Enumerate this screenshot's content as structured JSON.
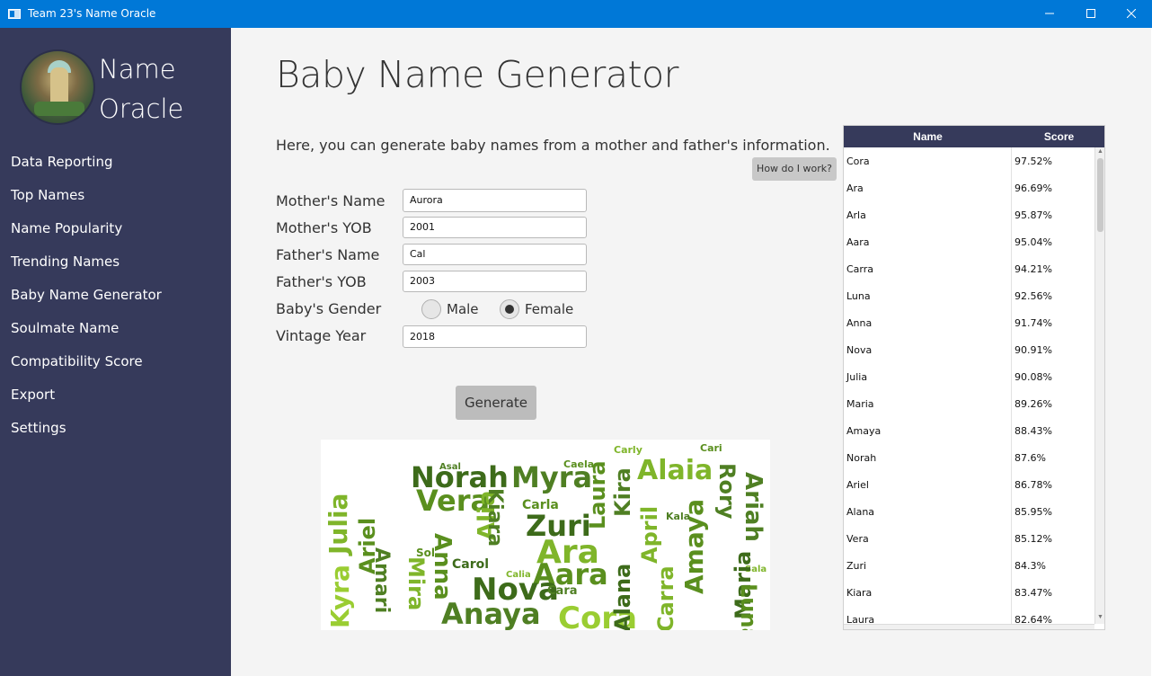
{
  "window": {
    "title": "Team 23's Name Oracle",
    "min_glyph": "—",
    "max_glyph": "☐",
    "close_glyph": "✕"
  },
  "sidebar": {
    "brand_line1": "Name",
    "brand_line2": "Oracle",
    "items": [
      {
        "label": "Data Reporting"
      },
      {
        "label": "Top Names"
      },
      {
        "label": "Name Popularity"
      },
      {
        "label": "Trending Names"
      },
      {
        "label": "Baby Name Generator"
      },
      {
        "label": "Soulmate Name"
      },
      {
        "label": "Compatibility Score"
      },
      {
        "label": "Export"
      },
      {
        "label": "Settings"
      }
    ]
  },
  "main": {
    "title": "Baby Name Generator",
    "intro": "Here, you can generate baby names from a mother and father's information.",
    "help_button": "How do I work?",
    "form": {
      "mother_name_label": "Mother's Name",
      "mother_name_value": "Aurora",
      "mother_yob_label": "Mother's YOB",
      "mother_yob_value": "2001",
      "father_name_label": "Father's Name",
      "father_name_value": "Cal",
      "father_yob_label": "Father's YOB",
      "father_yob_value": "2003",
      "gender_label": "Baby's Gender",
      "gender_male": "Male",
      "gender_female": "Female",
      "gender_selected": "Female",
      "vintage_label": "Vintage Year",
      "vintage_value": "2018"
    },
    "generate_button": "Generate"
  },
  "results": {
    "col_name": "Name",
    "col_score": "Score",
    "rows": [
      {
        "name": "Cora",
        "score": "97.52%"
      },
      {
        "name": "Ara",
        "score": "96.69%"
      },
      {
        "name": "Arla",
        "score": "95.87%"
      },
      {
        "name": "Aara",
        "score": "95.04%"
      },
      {
        "name": "Carra",
        "score": "94.21%"
      },
      {
        "name": "Luna",
        "score": "92.56%"
      },
      {
        "name": "Anna",
        "score": "91.74%"
      },
      {
        "name": "Nova",
        "score": "90.91%"
      },
      {
        "name": "Julia",
        "score": "90.08%"
      },
      {
        "name": "Maria",
        "score": "89.26%"
      },
      {
        "name": "Amaya",
        "score": "88.43%"
      },
      {
        "name": "Norah",
        "score": "87.6%"
      },
      {
        "name": "Ariel",
        "score": "86.78%"
      },
      {
        "name": "Alana",
        "score": "85.95%"
      },
      {
        "name": "Vera",
        "score": "85.12%"
      },
      {
        "name": "Zuri",
        "score": "84.3%"
      },
      {
        "name": "Kiara",
        "score": "83.47%"
      },
      {
        "name": "Laura",
        "score": "82.64%"
      }
    ]
  },
  "word_cloud": {
    "colors": [
      "#3d6b1a",
      "#5a8f1e",
      "#7fb52a",
      "#9acd32",
      "#4f7f23",
      "#2f5a12"
    ],
    "words": [
      {
        "text": "Norah",
        "color": "#3d6b1a"
      },
      {
        "text": "Myra",
        "color": "#4f7f23"
      },
      {
        "text": "Alaia",
        "color": "#7fb52a"
      },
      {
        "text": "Vera",
        "color": "#5a8f1e"
      },
      {
        "text": "Zuri",
        "color": "#3d6b1a"
      },
      {
        "text": "Ara",
        "color": "#7fb52a"
      },
      {
        "text": "Aara",
        "color": "#5a8f1e"
      },
      {
        "text": "Nova",
        "color": "#3d6b1a"
      },
      {
        "text": "Anaya",
        "color": "#4f7f23"
      },
      {
        "text": "Cora",
        "color": "#9acd32"
      },
      {
        "text": "Carla",
        "color": "#5a8f1e"
      },
      {
        "text": "Carol",
        "color": "#3d6b1a"
      },
      {
        "text": "Cara",
        "color": "#4f7f23"
      },
      {
        "text": "Caela",
        "color": "#5a8f1e"
      },
      {
        "text": "Carly",
        "color": "#7fb52a"
      },
      {
        "text": "Cari",
        "color": "#5a8f1e"
      },
      {
        "text": "Asal",
        "color": "#4f7f23"
      },
      {
        "text": "Sol",
        "color": "#5a8f1e"
      },
      {
        "text": "Kala",
        "color": "#4f7f23"
      },
      {
        "text": "Calia",
        "color": "#7fb52a"
      },
      {
        "text": "Sala",
        "color": "#7fb52a"
      },
      {
        "text": "Julia",
        "color": "#7fb52a"
      },
      {
        "text": "Kyra",
        "color": "#9acd32"
      },
      {
        "text": "Ariel",
        "color": "#5a8f1e"
      },
      {
        "text": "Amari",
        "color": "#4f7f23"
      },
      {
        "text": "Anna",
        "color": "#5a8f1e"
      },
      {
        "text": "Mira",
        "color": "#7fb52a"
      },
      {
        "text": "Alia",
        "color": "#7fb52a"
      },
      {
        "text": "Laura",
        "color": "#5a8f1e"
      },
      {
        "text": "Kiara",
        "color": "#4f7f23"
      },
      {
        "text": "April",
        "color": "#7fb52a"
      },
      {
        "text": "Amaya",
        "color": "#5a8f1e"
      },
      {
        "text": "Ariah",
        "color": "#4f7f23"
      },
      {
        "text": "Rory",
        "color": "#4f7f23"
      },
      {
        "text": "Kira",
        "color": "#4f7f23"
      },
      {
        "text": "Alana",
        "color": "#3d6b1a"
      },
      {
        "text": "Maria",
        "color": "#3d6b1a"
      },
      {
        "text": "Carra",
        "color": "#7fb52a"
      },
      {
        "text": "Luna",
        "color": "#5a8f1e"
      }
    ]
  }
}
